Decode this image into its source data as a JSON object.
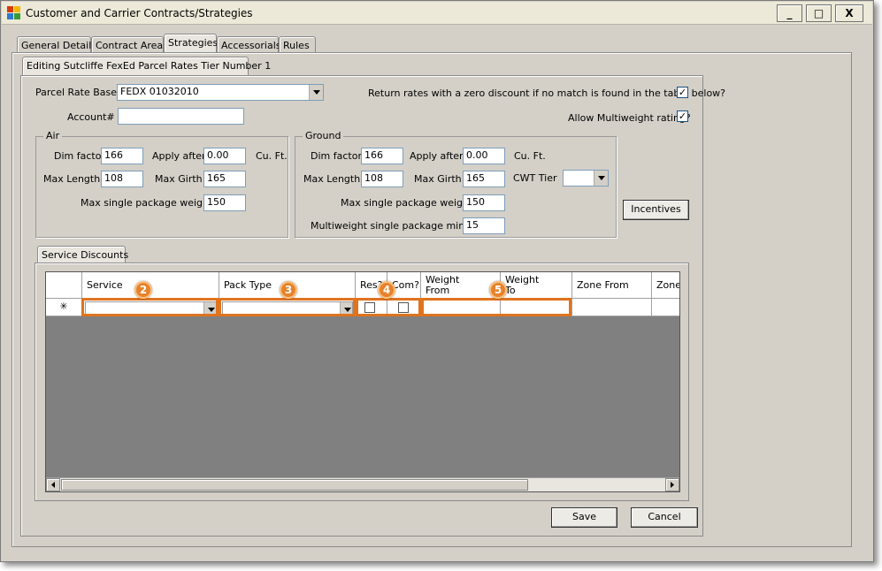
{
  "window": {
    "title": "Customer and Carrier Contracts/Strategies",
    "controls": {
      "minimize": "_",
      "maximize": "□",
      "close": "X"
    }
  },
  "tabs": [
    {
      "label": "General Details"
    },
    {
      "label": "Contract Areas"
    },
    {
      "label": "Strategies"
    },
    {
      "label": "Accessorials"
    },
    {
      "label": "Rules"
    }
  ],
  "subtab": {
    "label": "Editing Sutcliffe FexEd Parcel Rates Tier Number 1"
  },
  "form": {
    "parcel_rate_base_label": "Parcel Rate Base",
    "parcel_rate_base_value": "FEDX 01032010",
    "account_label": "Account#",
    "account_value": "",
    "zero_discount_label": "Return rates with a zero discount if no match is found in the table below?",
    "zero_discount_checked": "✓",
    "multiweight_label": "Allow Multiweight rating?",
    "multiweight_checked": "✓"
  },
  "air": {
    "title": "Air",
    "dim_factor_label": "Dim factor",
    "dim_factor_value": "166",
    "apply_after_label": "Apply after",
    "apply_after_value": "0.00",
    "unit_label": "Cu. Ft.",
    "max_length_label": "Max Length",
    "max_length_value": "108",
    "max_girth_label": "Max Girth",
    "max_girth_value": "165",
    "max_single_label": "Max single package weight",
    "max_single_value": "150"
  },
  "ground": {
    "title": "Ground",
    "dim_factor_label": "Dim factor",
    "dim_factor_value": "166",
    "apply_after_label": "Apply after",
    "apply_after_value": "0.00",
    "unit_label": "Cu. Ft.",
    "max_length_label": "Max Length",
    "max_length_value": "108",
    "max_girth_label": "Max Girth",
    "max_girth_value": "165",
    "cwt_tier_label": "CWT Tier",
    "cwt_tier_value": "",
    "max_single_label": "Max single package weight",
    "max_single_value": "150",
    "multiweight_min_label": "Multiweight single package min.wt.",
    "multiweight_min_value": "15"
  },
  "buttons": {
    "incentives": "Incentives",
    "save": "Save",
    "cancel": "Cancel"
  },
  "service_discounts": {
    "tab_label": "Service Discounts",
    "new_row_marker": "✳",
    "columns": [
      {
        "label": "Service"
      },
      {
        "label": "Pack Type"
      },
      {
        "label": "Res?"
      },
      {
        "label": "Com?"
      },
      {
        "label": "Weight From"
      },
      {
        "label": "Weight To"
      },
      {
        "label": "Zone From"
      },
      {
        "label": "Zone"
      }
    ]
  },
  "callouts": [
    "2",
    "3",
    "4",
    "5"
  ],
  "colors": {
    "highlight": "#e0731e",
    "callout": "#e8822a"
  }
}
